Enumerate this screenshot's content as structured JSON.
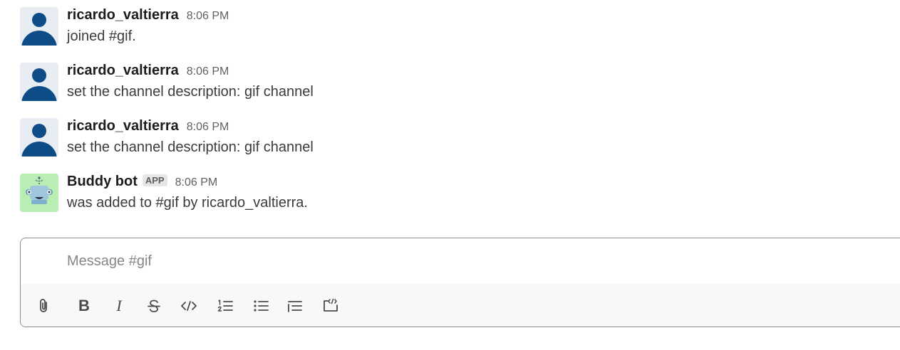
{
  "messages": [
    {
      "author": "ricardo_valtierra",
      "time": "8:06 PM",
      "text": "joined #gif.",
      "avatar": "user-avatar-icon"
    },
    {
      "author": "ricardo_valtierra",
      "time": "8:06 PM",
      "text": "set the channel description: gif channel",
      "avatar": "user-avatar-icon"
    },
    {
      "author": "ricardo_valtierra",
      "time": "8:06 PM",
      "text": "set the channel description: gif channel",
      "avatar": "user-avatar-icon"
    },
    {
      "author": "Buddy bot",
      "badge": "APP",
      "time": "8:06 PM",
      "text": "was added to #gif by ricardo_valtierra.",
      "avatar": "robot-avatar-icon"
    }
  ],
  "composer": {
    "placeholder": "Message #gif",
    "value": ""
  },
  "toolbar": {
    "tools": [
      "attach-icon",
      "bold-icon",
      "italic-icon",
      "strikethrough-icon",
      "code-icon",
      "numbered-list-icon",
      "bulleted-list-icon",
      "blockquote-icon",
      "code-block-icon"
    ],
    "bold_glyph": "B",
    "italic_glyph": "I"
  },
  "colors": {
    "avatar_blue": "#0e4c87",
    "bot_avatar_bg": "#b8edb4",
    "border": "#8d8d8d"
  }
}
